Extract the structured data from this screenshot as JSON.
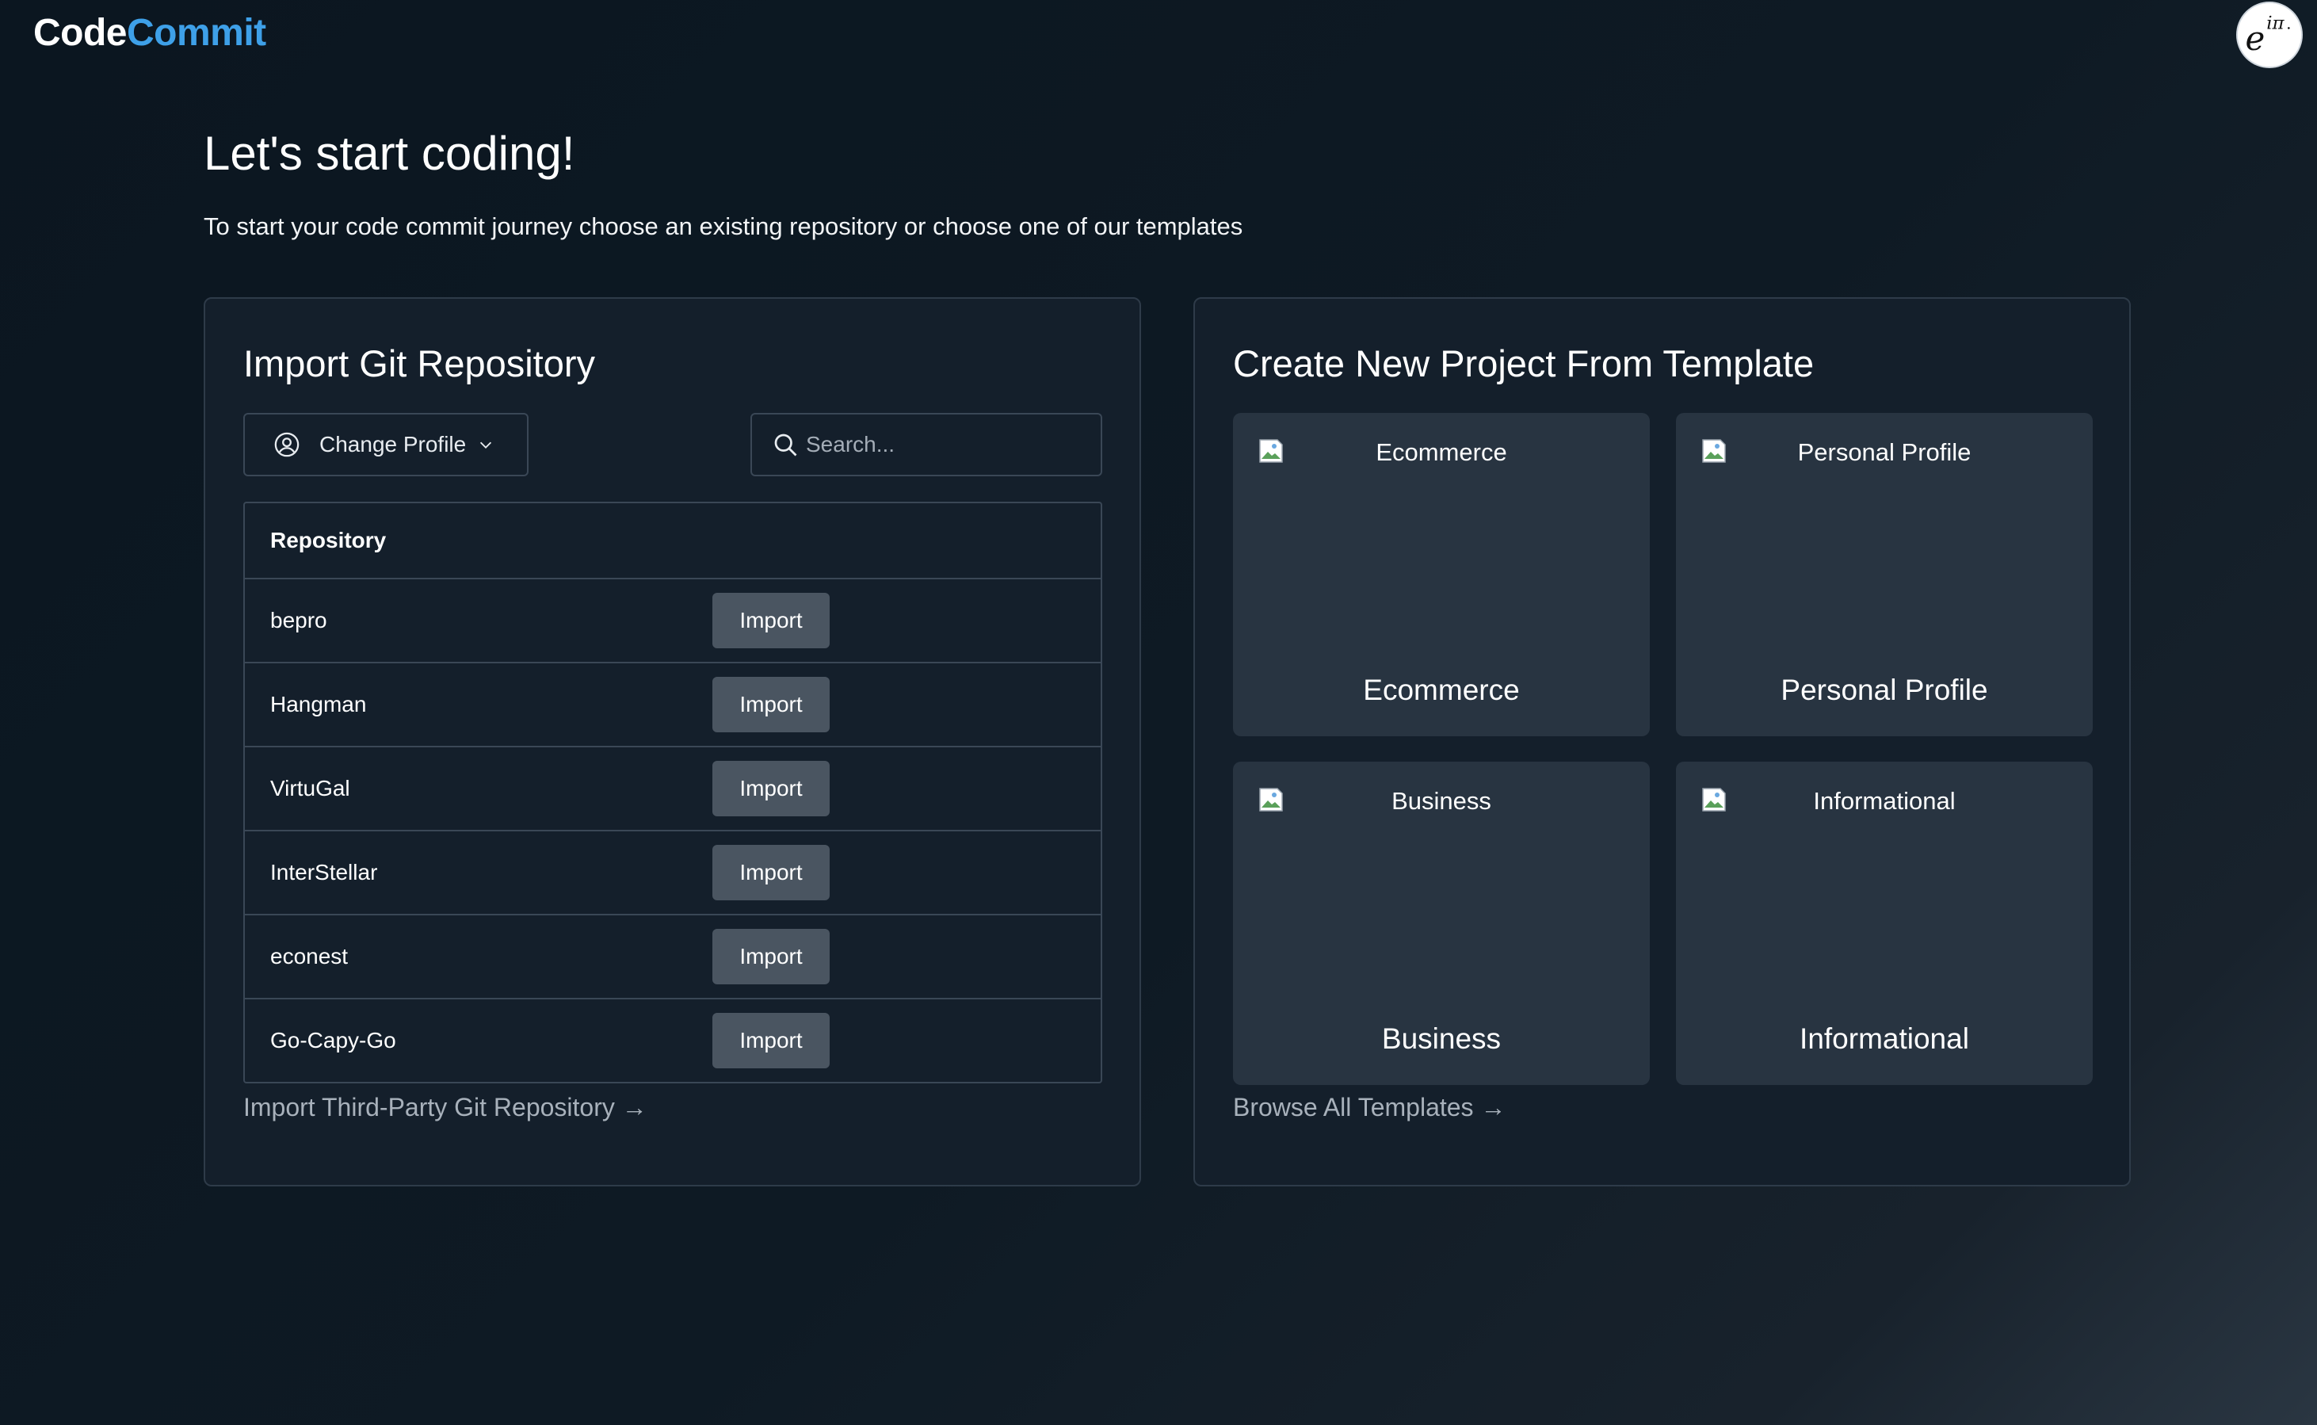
{
  "header": {
    "logo_part1": "Code",
    "logo_part2": "Commit"
  },
  "intro": {
    "title": "Let's start coding!",
    "subtitle": "To start your code commit journey choose an existing repository or choose one of our templates"
  },
  "import_panel": {
    "title": "Import Git Repository",
    "profile_button": "Change Profile",
    "search_placeholder": "Search...",
    "table_header": "Repository",
    "import_label": "Import",
    "repositories": [
      {
        "name": "bepro"
      },
      {
        "name": "Hangman"
      },
      {
        "name": "VirtuGal"
      },
      {
        "name": "InterStellar"
      },
      {
        "name": "econest"
      },
      {
        "name": "Go-Capy-Go"
      }
    ],
    "footer_link": "Import Third-Party Git Repository →"
  },
  "template_panel": {
    "title": "Create New Project From Template",
    "templates": [
      {
        "alt": "Ecommerce",
        "title": "Ecommerce"
      },
      {
        "alt": "Personal Profile",
        "title": "Personal Profile"
      },
      {
        "alt": "Business",
        "title": "Business"
      },
      {
        "alt": "Informational",
        "title": "Informational"
      }
    ],
    "footer_link": "Browse All Templates →"
  },
  "colors": {
    "background": "#0e1a24",
    "panel": "#141f2b",
    "card": "#283441",
    "accent": "#3ea0e8",
    "button": "#4a5561"
  },
  "icons": {
    "profile": "user-circle-icon",
    "chevron": "chevron-down-icon",
    "search": "search-icon",
    "avatar": "euler-avatar"
  }
}
